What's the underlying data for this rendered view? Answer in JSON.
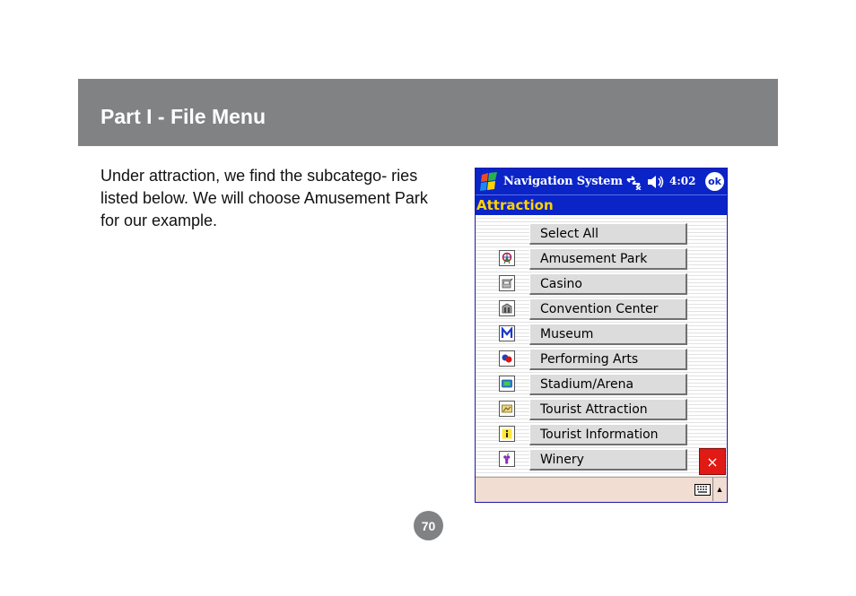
{
  "header": {
    "title": "Part I - File Menu"
  },
  "body": {
    "paragraph": "Under attraction, we find the subcatego- ries listed below.  We will choose Amusement Park for our example."
  },
  "page_number": "70",
  "device": {
    "titlebar": {
      "app_name": "Navigation System",
      "time": "4:02",
      "ok_label": "ok"
    },
    "category_title": "Attraction",
    "items": [
      {
        "label": "Select All",
        "icon": ""
      },
      {
        "label": "Amusement Park",
        "icon": "ferris-wheel-icon"
      },
      {
        "label": "Casino",
        "icon": "slot-machine-icon"
      },
      {
        "label": "Convention Center",
        "icon": "convention-building-icon"
      },
      {
        "label": "Museum",
        "icon": "museum-m-icon"
      },
      {
        "label": "Performing Arts",
        "icon": "theater-masks-icon"
      },
      {
        "label": "Stadium/Arena",
        "icon": "stadium-icon"
      },
      {
        "label": "Tourist Attraction",
        "icon": "tourist-attraction-icon"
      },
      {
        "label": "Tourist Information",
        "icon": "info-i-icon"
      },
      {
        "label": "Winery",
        "icon": "grapes-icon"
      }
    ],
    "close_label": "×",
    "sip_arrow": "▲"
  },
  "colors": {
    "header_bg": "#808284",
    "title_bar": "#0a24c8",
    "category_text": "#ffd200",
    "close_button": "#e01a14"
  }
}
